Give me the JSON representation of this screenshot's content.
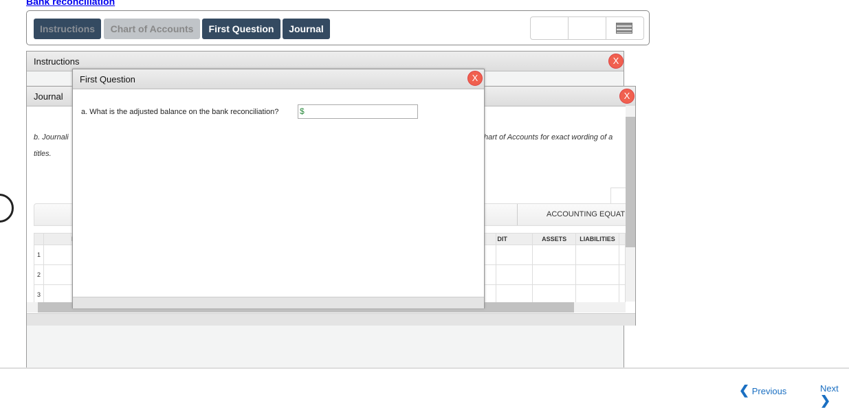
{
  "title": "Bank reconciliation",
  "tabs": [
    {
      "label": "Instructions"
    },
    {
      "label": "Chart of Accounts"
    },
    {
      "label": "First Question"
    },
    {
      "label": "Journal"
    }
  ],
  "instructions": {
    "title": "Instructions",
    "close": "X"
  },
  "journal": {
    "title": "Journal",
    "close": "X",
    "text_left": "b. Journali",
    "text_right": "hart of Accounts for exact wording of a",
    "text_line2": "titles.",
    "equation_header": "ACCOUNTING EQUATI",
    "columns": [
      "D",
      "DIT",
      "ASSETS",
      "LIABILITIES"
    ],
    "rows": [
      "1",
      "2",
      "3"
    ]
  },
  "dialog": {
    "title": "First Question",
    "close": "X",
    "question": "a. What is the adjusted balance on the bank reconciliation?",
    "currency": "$",
    "answer": ""
  },
  "footer": {
    "previous": "Previous",
    "next": "Next"
  }
}
